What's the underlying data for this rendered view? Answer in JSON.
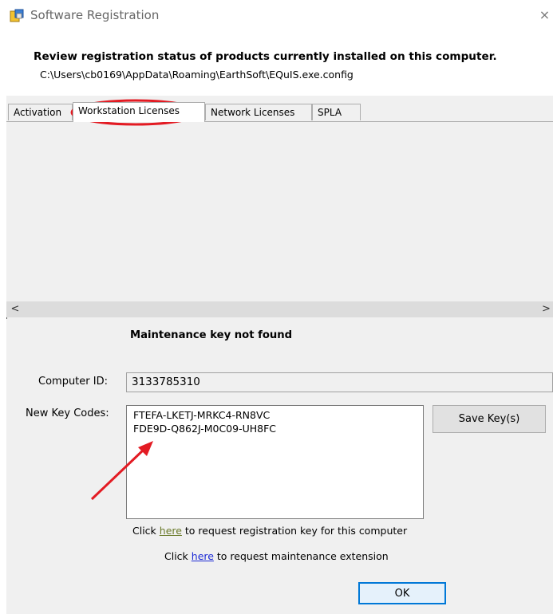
{
  "window": {
    "title": "Software Registration",
    "close_glyph": "×"
  },
  "header": {
    "heading": "Review registration status of products currently installed on this computer.",
    "config_path": "C:\\Users\\cb0169\\AppData\\Roaming\\EarthSoft\\EQuIS.exe.config"
  },
  "tabs": [
    {
      "label": "Activation"
    },
    {
      "label": "Workstation Licenses",
      "active": true
    },
    {
      "label": "Network Licenses"
    },
    {
      "label": "SPLA"
    }
  ],
  "scroll": {
    "left_glyph": "<",
    "right_glyph": ">"
  },
  "maintenance_status": "Maintenance key not found",
  "computer_id": {
    "label": "Computer ID:",
    "value": "3133785310"
  },
  "key_codes": {
    "label": "New Key Codes:",
    "lines": [
      "FTEFA-LKETJ-MRKC4-RN8VC",
      "FDE9D-Q862J-M0C09-UH8FC"
    ]
  },
  "buttons": {
    "save": "Save Key(s)",
    "ok": "OK"
  },
  "links": {
    "registration": {
      "prefix": "Click ",
      "link": "here",
      "suffix": " to request registration key for this computer"
    },
    "maintenance": {
      "prefix": "Click ",
      "link": "here",
      "suffix": " to request maintenance extension"
    }
  },
  "colors": {
    "annotation": "#e31b23",
    "accent": "#0078d7"
  }
}
